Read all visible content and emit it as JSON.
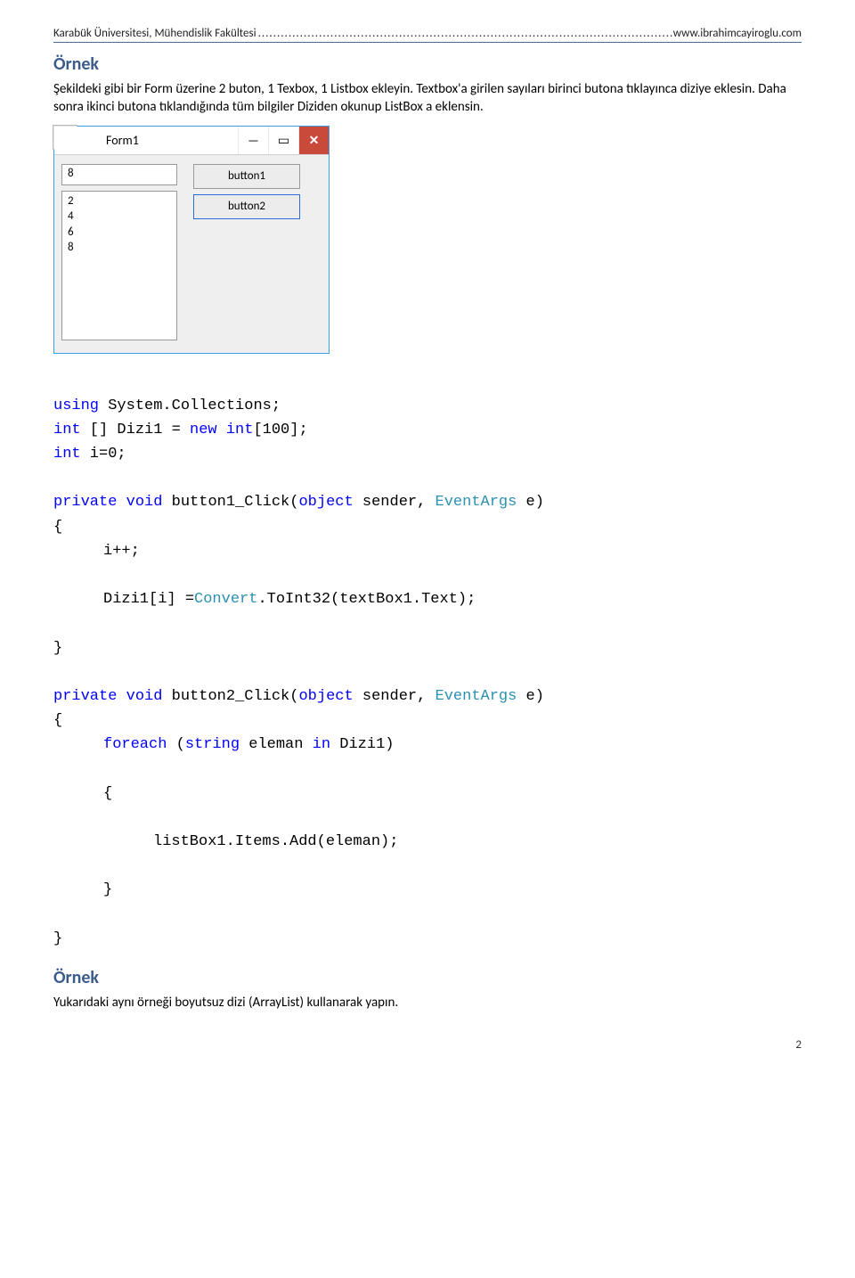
{
  "header": {
    "left": "Karabük Üniversitesi, Mühendislik Fakültesi",
    "dots": ".................................................................................................................",
    "right": "www.ibrahimcayiroglu.com"
  },
  "heading1": "Örnek",
  "para1": "Şekildeki gibi bir Form üzerine 2 buton, 1 Texbox, 1 Listbox ekleyin. Textbox'a girilen sayıları birinci butona tıklayınca diziye eklesin. Daha sonra ikinci butona tıklandığında tüm bilgiler Diziden okunup ListBox a eklensin.",
  "form": {
    "title": "Form1",
    "textbox_value": "8",
    "listbox_lines": "2\n4\n6\n8",
    "button1": "button1",
    "button2": "button2",
    "minimize": "—",
    "maximize": "▭",
    "close": "✕"
  },
  "code": {
    "l1a": "using",
    "l1b": " System.Collections;",
    "l2a": "int",
    "l2b": " [] Dizi1 = ",
    "l2c": "new",
    "l2d": " ",
    "l2e": "int",
    "l2f": "[100];",
    "l3a": "int",
    "l3b": " i=0;",
    "l4a": "private",
    "l4b": " ",
    "l4c": "void",
    "l4d": " button1_Click(",
    "l4e": "object",
    "l4f": " sender, ",
    "l4g": "EventArgs",
    "l4h": " e)",
    "l5": "{",
    "l6": "i++;",
    "l7a": "Dizi1[i] =",
    "l7b": "Convert",
    "l7c": ".ToInt32(textBox1.Text);",
    "l8": "}",
    "l9a": "private",
    "l9b": " ",
    "l9c": "void",
    "l9d": " button2_Click(",
    "l9e": "object",
    "l9f": " sender, ",
    "l9g": "EventArgs",
    "l9h": " e)",
    "l10": "{",
    "l11a": "foreach",
    "l11b": " (",
    "l11c": "string",
    "l11d": " eleman ",
    "l11e": "in",
    "l11f": " Dizi1)",
    "l12": "{",
    "l13": "listBox1.Items.Add(eleman);",
    "l14": "}",
    "l15": "}"
  },
  "heading2": "Örnek",
  "para2": "Yukarıdaki aynı örneği boyutsuz dizi (ArrayList) kullanarak yapın.",
  "pagenum": "2"
}
